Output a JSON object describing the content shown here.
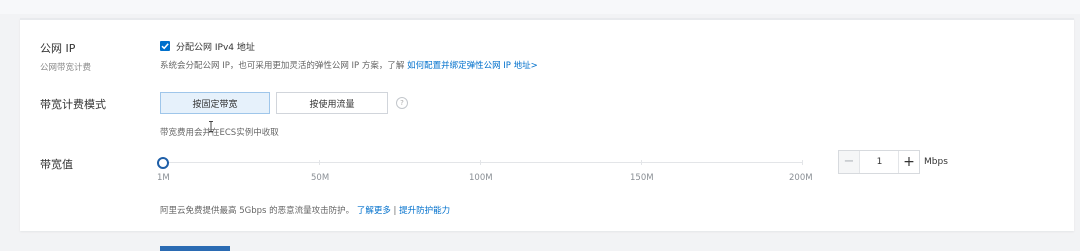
{
  "public_ip": {
    "label": "公网 IP",
    "sub_label": "公网带宽计费",
    "checkbox_label": "分配公网 IPv4 地址",
    "checked": true,
    "hint_text": "系统会分配公网 IP，也可采用更加灵活的弹性公网 IP 方案，了解 ",
    "hint_link": "如何配置并绑定弹性公网 IP 地址>"
  },
  "billing": {
    "label": "带宽计费模式",
    "options": [
      "按固定带宽",
      "按使用流量"
    ],
    "selected": "按固定带宽",
    "help_icon": "?",
    "note": "带宽费用会并在ECS实例中收取"
  },
  "bandwidth": {
    "label": "带宽值",
    "ticks": [
      "1M",
      "50M",
      "100M",
      "150M",
      "200M"
    ],
    "slider_value": 1,
    "slider_max": 200,
    "stepper_value": "1",
    "minus_label": "−",
    "plus_label": "+",
    "unit": "Mbps",
    "note_text": "阿里云免费提供最高 5Gbps 的恶意流量攻击防护。",
    "link_more": "了解更多",
    "separator": "|",
    "link_upgrade": "提升防护能力"
  },
  "colors": {
    "accent": "#0070cc",
    "active_bg": "#e6f1fb",
    "slider_handle": "#1f5fa8"
  }
}
